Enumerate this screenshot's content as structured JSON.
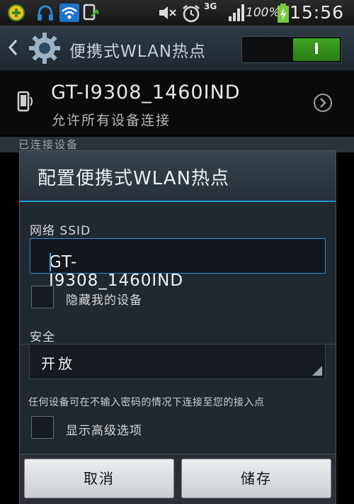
{
  "status_bar": {
    "network_type": "3G",
    "battery_percent": "100%",
    "time": "15:56",
    "icons": [
      "game-icon",
      "headset-icon",
      "wifi-icon",
      "usb-icon",
      "mute-icon",
      "alarm-icon",
      "signal-icon",
      "battery-charging-icon"
    ]
  },
  "action_bar": {
    "title": "便携式WLAN热点",
    "toggle_label": "I",
    "toggle_on": true
  },
  "hotspot": {
    "name": "GT-I9308_1460IND",
    "subtitle": "允许所有设备连接"
  },
  "section": {
    "connected_header": "已连接设备"
  },
  "dialog": {
    "title": "配置便携式WLAN热点",
    "ssid_label": "网络 SSID",
    "ssid_value": "GT-I9308_1460IND",
    "hide_device_label": "隐藏我的设备",
    "security_label": "安全",
    "security_value": "开放",
    "security_hint": "任何设备可在不输入密码的情况下连接至您的接入点",
    "advanced_label": "显示高级选项",
    "cancel_label": "取消",
    "save_label": "储存"
  },
  "colors": {
    "accent_blue": "#1a9bd7",
    "toggle_green": "#3ea521"
  }
}
